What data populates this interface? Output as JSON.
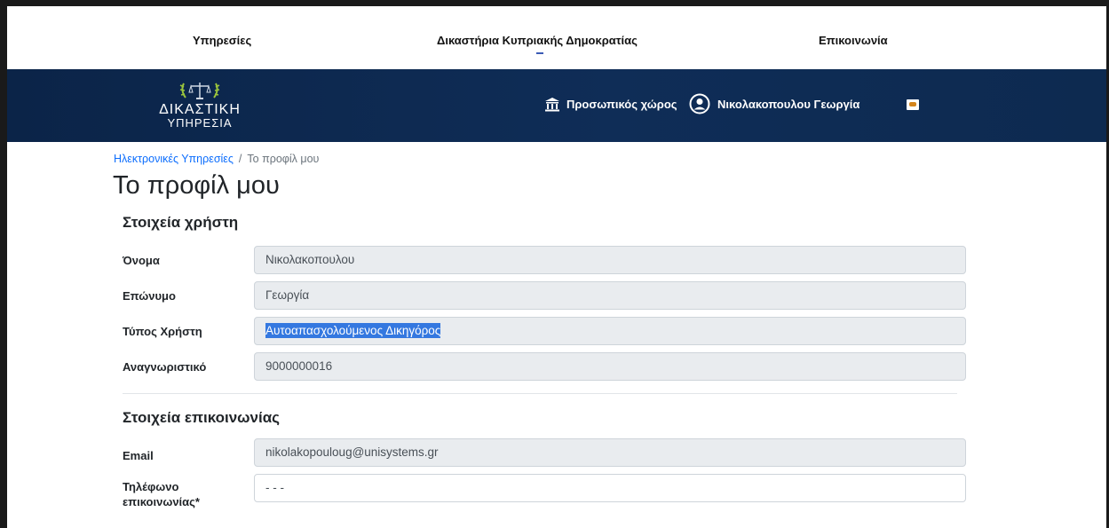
{
  "topnav": {
    "items": [
      "Υπηρεσίες",
      "Δικαστήρια Κυπριακής Δημοκρατίας",
      "Επικοινωνία"
    ]
  },
  "header": {
    "logo_line1": "ΔΙΚΑΣΤΙΚΗ",
    "logo_line2": "ΥΠΗΡΕΣΙΑ",
    "personal_space": "Προσωπικός χώρος",
    "user_name": "Νικολακοπουλου Γεωργία"
  },
  "breadcrumb": {
    "parent": "Ηλεκτρονικές Υπηρεσίες",
    "separator": "/",
    "current": "Το προφίλ μου"
  },
  "page_title": "Το προφίλ μου",
  "user_section": {
    "title": "Στοιχεία χρήστη",
    "fields": [
      {
        "label": "Όνομα",
        "value": "Νικολακοπουλου"
      },
      {
        "label": "Επώνυμο",
        "value": "Γεωργία"
      },
      {
        "label": "Τύπος Χρήστη",
        "value": "Αυτοαπασχολούμενος Δικηγόρος"
      },
      {
        "label": "Αναγνωριστικό",
        "value": "9000000016"
      }
    ]
  },
  "contact_section": {
    "title": "Στοιχεία επικοινωνίας",
    "email_label": "Email",
    "email_value": "nikolakopouloug@unisystems.gr",
    "phone_label_line1": "Τηλέφωνο",
    "phone_label_line2": "επικοινωνίας*",
    "phone_value": "- - -"
  },
  "colors": {
    "header_bg": "#0f2d57",
    "link": "#0d6efd",
    "selection": "#3478e0",
    "readonly_field": "#e9ecef"
  }
}
